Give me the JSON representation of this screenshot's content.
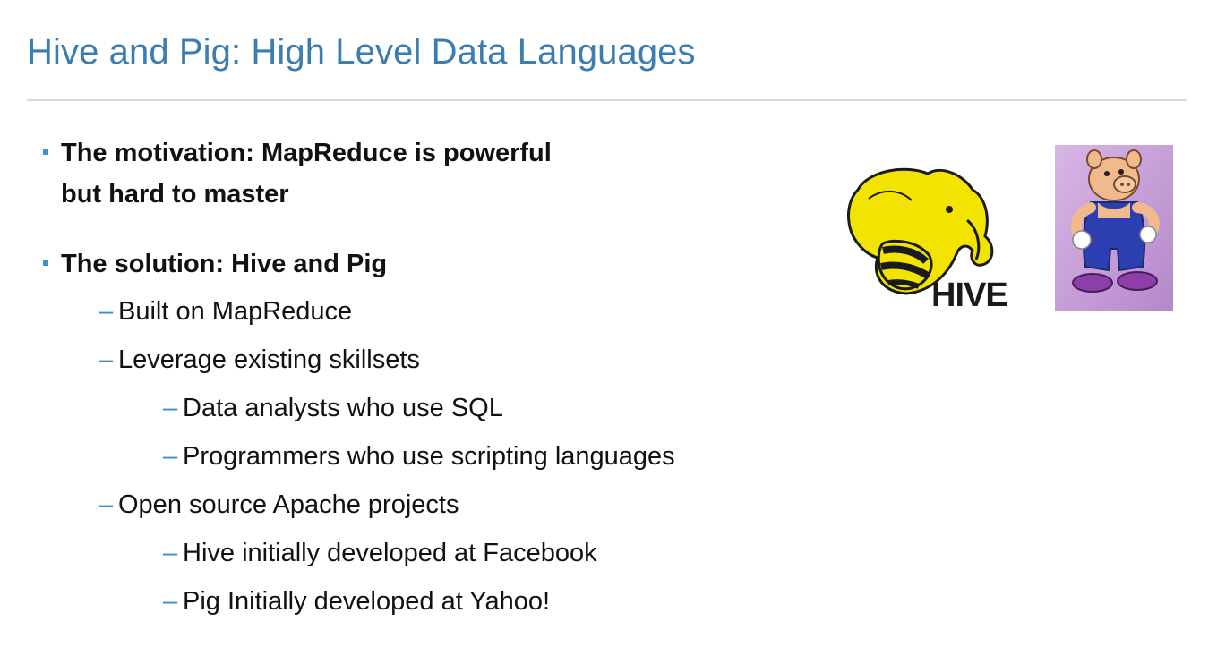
{
  "slide": {
    "title": "Hive and Pig: High Level Data Languages",
    "bullets": [
      {
        "text_line1": "The motivation: MapReduce is powerful",
        "text_line2": "but hard to master"
      },
      {
        "text": "The solution: Hive and Pig"
      }
    ],
    "sub_items": {
      "built_on": "Built on MapReduce",
      "leverage": "Leverage existing skillsets",
      "analysts": "Data analysts who use SQL",
      "programmers": "Programmers who use scripting languages",
      "open_source": "Open source Apache projects",
      "hive_fb": "Hive initially developed at Facebook",
      "pig_yahoo": "Pig Initially developed at Yahoo!"
    },
    "dash_glyph": "–",
    "logos": {
      "hive_wordmark": "HIVE"
    },
    "colors": {
      "title": "#3a7db1",
      "bullet_marker": "#3a95c9",
      "hive_yellow": "#f2e400",
      "pig_background": "#c9a2d9"
    }
  }
}
